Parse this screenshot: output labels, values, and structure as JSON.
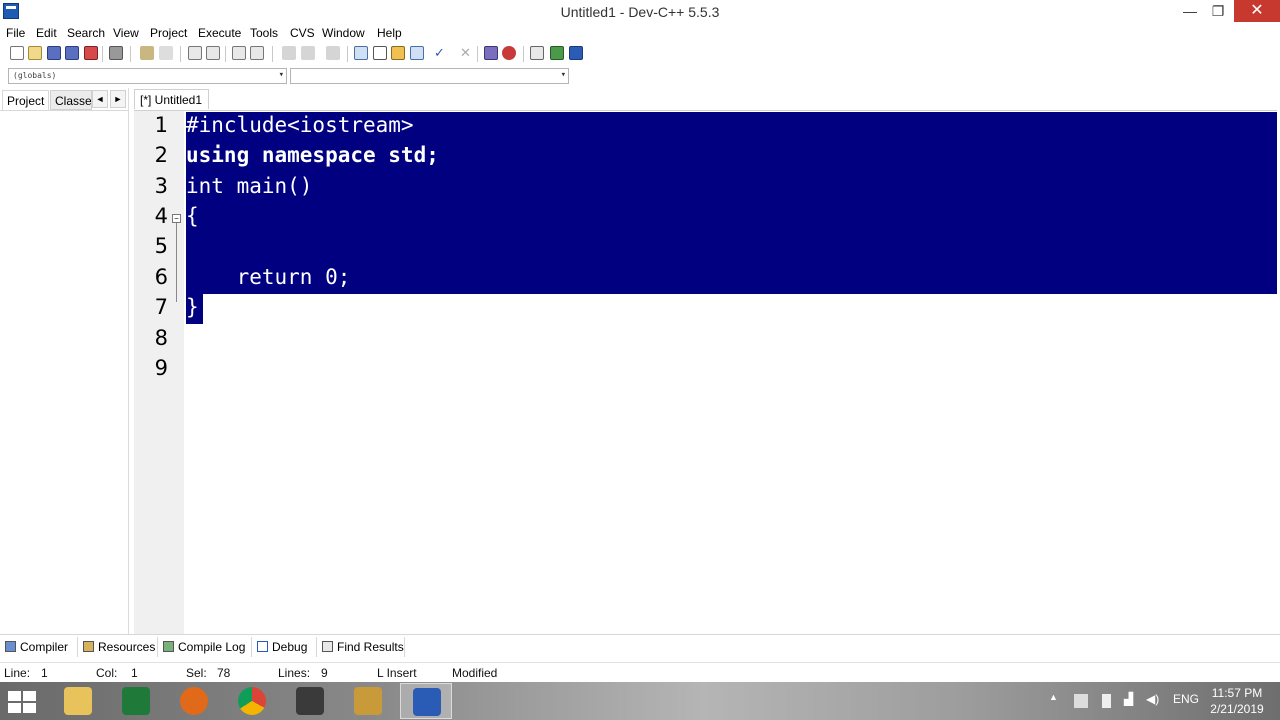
{
  "window": {
    "title": "Untitled1 - Dev-C++ 5.5.3",
    "minimize": "—",
    "maximize": "❐",
    "close": "✕"
  },
  "menu": [
    "File",
    "Edit",
    "Search",
    "View",
    "Project",
    "Execute",
    "Tools",
    "CVS",
    "Window",
    "Help"
  ],
  "combos": {
    "scope": "(globals)",
    "members": ""
  },
  "left_panel": {
    "tabs": [
      "Project",
      "Classes"
    ],
    "arrow_left": "◄",
    "arrow_right": "►"
  },
  "editor": {
    "tab_label": "[*] Untitled1",
    "lines": [
      {
        "num": "1",
        "text": "#include<iostream>"
      },
      {
        "num": "2",
        "text": "using namespace std;"
      },
      {
        "num": "3",
        "text": "int main()"
      },
      {
        "num": "4",
        "text": "{"
      },
      {
        "num": "5",
        "text": ""
      },
      {
        "num": "6",
        "text": "    return 0;"
      },
      {
        "num": "7",
        "text": "}"
      },
      {
        "num": "8",
        "text": ""
      },
      {
        "num": "9",
        "text": ""
      }
    ],
    "selection_color": "#000080"
  },
  "bottom_tabs": [
    "Compiler",
    "Resources",
    "Compile Log",
    "Debug",
    "Find Results"
  ],
  "status": {
    "line_label": "Line:",
    "line_value": "1",
    "col_label": "Col:",
    "col_value": "1",
    "sel_label": "Sel:",
    "sel_value": "78",
    "lines_label": "Lines:",
    "lines_value": "9",
    "mode": "L Insert",
    "state": "Modified"
  },
  "taskbar": {
    "apps": [
      "file-explorer",
      "excel",
      "firefox",
      "chrome",
      "media",
      "paint",
      "dev-cpp"
    ],
    "language": "ENG",
    "time": "11:57 PM",
    "date": "2/21/2019"
  }
}
